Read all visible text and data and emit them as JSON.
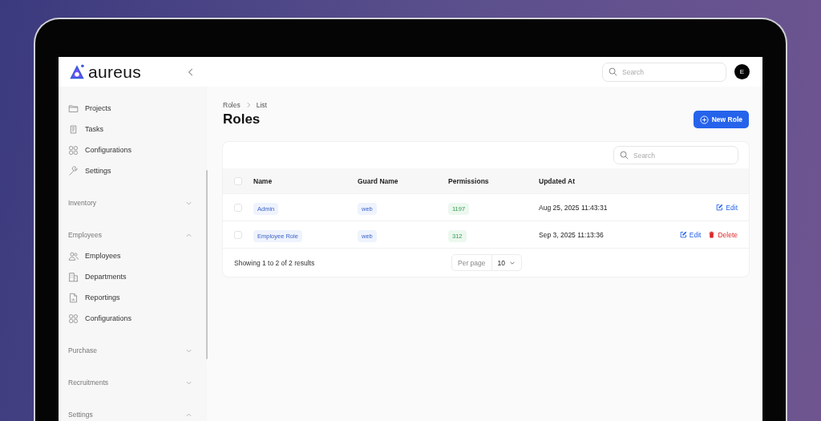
{
  "brand": {
    "name": "aureus"
  },
  "header": {
    "search": {
      "placeholder": "Search"
    },
    "avatar": "E"
  },
  "sidebar": {
    "items": [
      {
        "label": "Projects"
      },
      {
        "label": "Tasks"
      },
      {
        "label": "Configurations"
      },
      {
        "label": "Settings"
      }
    ],
    "groups": [
      {
        "label": "Inventory",
        "expanded": false
      },
      {
        "label": "Employees",
        "expanded": true,
        "items": [
          {
            "label": "Employees"
          },
          {
            "label": "Departments"
          },
          {
            "label": "Reportings"
          },
          {
            "label": "Configurations"
          }
        ]
      },
      {
        "label": "Purchase",
        "expanded": false
      },
      {
        "label": "Recruitments",
        "expanded": false
      },
      {
        "label": "Settings",
        "expanded": true
      }
    ]
  },
  "breadcrumb": [
    "Roles",
    "List"
  ],
  "title": "Roles",
  "primary_button": "New Role",
  "table": {
    "search": {
      "placeholder": "Search"
    },
    "all_checked": false,
    "columns": [
      "Name",
      "Guard Name",
      "Permissions",
      "Updated At"
    ],
    "rows": [
      {
        "checked": false,
        "name": "Admin",
        "guard": "web",
        "permissions": "1197",
        "updated": "Aug 25, 2025 11:43:31",
        "actions": [
          {
            "kind": "edit",
            "label": "Edit"
          }
        ]
      },
      {
        "checked": false,
        "name": "Employee Role",
        "guard": "web",
        "permissions": "312",
        "updated": "Sep 3, 2025 11:13:36",
        "actions": [
          {
            "kind": "edit",
            "label": "Edit"
          },
          {
            "kind": "delete",
            "label": "Delete"
          }
        ]
      }
    ],
    "summary": "Showing 1 to 2 of 2 results",
    "per_page": {
      "label": "Per page",
      "value": "10"
    }
  }
}
